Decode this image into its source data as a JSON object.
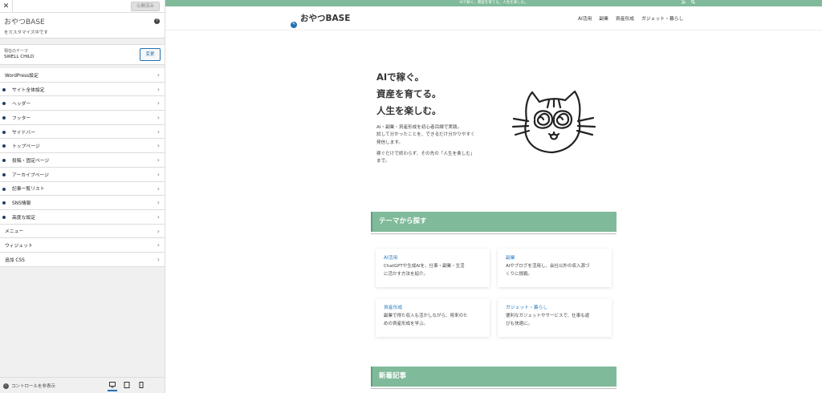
{
  "panel": {
    "close_icon": "close-icon",
    "publish_label": "公開済み",
    "site_title": "おやつBASE",
    "site_subtitle": "をカスタマイズ中です",
    "theme_label": "現在のテーマ",
    "theme_name": "SWELL CHILD",
    "change_label": "変更",
    "menu": [
      {
        "label": "WordPress設定",
        "dot": false
      },
      {
        "label": "サイト全体設定",
        "dot": true
      },
      {
        "label": "ヘッダー",
        "dot": true
      },
      {
        "label": "フッター",
        "dot": true
      },
      {
        "label": "サイドバー",
        "dot": true
      },
      {
        "label": "トップページ",
        "dot": true
      },
      {
        "label": "投稿・固定ページ",
        "dot": true
      },
      {
        "label": "アーカイブページ",
        "dot": true
      },
      {
        "label": "記事一覧リスト",
        "dot": true
      },
      {
        "label": "SNS情報",
        "dot": true
      },
      {
        "label": "高度な設定",
        "dot": true
      },
      {
        "label": "メニュー",
        "dot": false
      },
      {
        "label": "ウィジェット",
        "dot": false
      },
      {
        "label": "追加 CSS",
        "dot": false
      }
    ],
    "hide_controls_label": "コントロールを非表示",
    "device_active": "desktop"
  },
  "preview": {
    "promo_text": "AIで稼ぐ。資産を育てる。人生を楽しむ。",
    "logo": "おやつBASE",
    "nav": [
      "AI活用",
      "副業",
      "資産形成",
      "ガジェット・暮らし"
    ],
    "hero": {
      "line1": "AIで稼ぐ。",
      "line2": "資産を育てる。",
      "line3": "人生を楽しむ。",
      "p1a": "AI・副業・資産形成を初心者目線で実践。",
      "p1b": "試して分かったことを、できるだけ分かりやすく",
      "p1c": "発信します。",
      "p2a": "稼ぐだけで終わらず、その先の「人生を楽しむ」",
      "p2b": "まで。"
    },
    "section1_title": "テーマから探す",
    "cards": [
      {
        "title": "AI活用",
        "desc1": "ChatGPTや生成AIを、仕事・副業・生活",
        "desc2": "に活かす方法を紹介。"
      },
      {
        "title": "副業",
        "desc1": "AIやブログを活用し、会社以外の収入源づ",
        "desc2": "くりに挑戦。"
      },
      {
        "title": "資産形成",
        "desc1": "副業で得た収入も活かしながら、将来のた",
        "desc2": "めの資産形成を学ぶ。"
      },
      {
        "title": "ガジェット・暮らし",
        "desc1": "便利なガジェットやサービスで、仕事も遊",
        "desc2": "びも快適に。"
      }
    ],
    "section2_title": "新着記事"
  },
  "colors": {
    "accent": "#7fba9a",
    "link": "#2b7cc0",
    "wp_blue": "#2271b1"
  }
}
